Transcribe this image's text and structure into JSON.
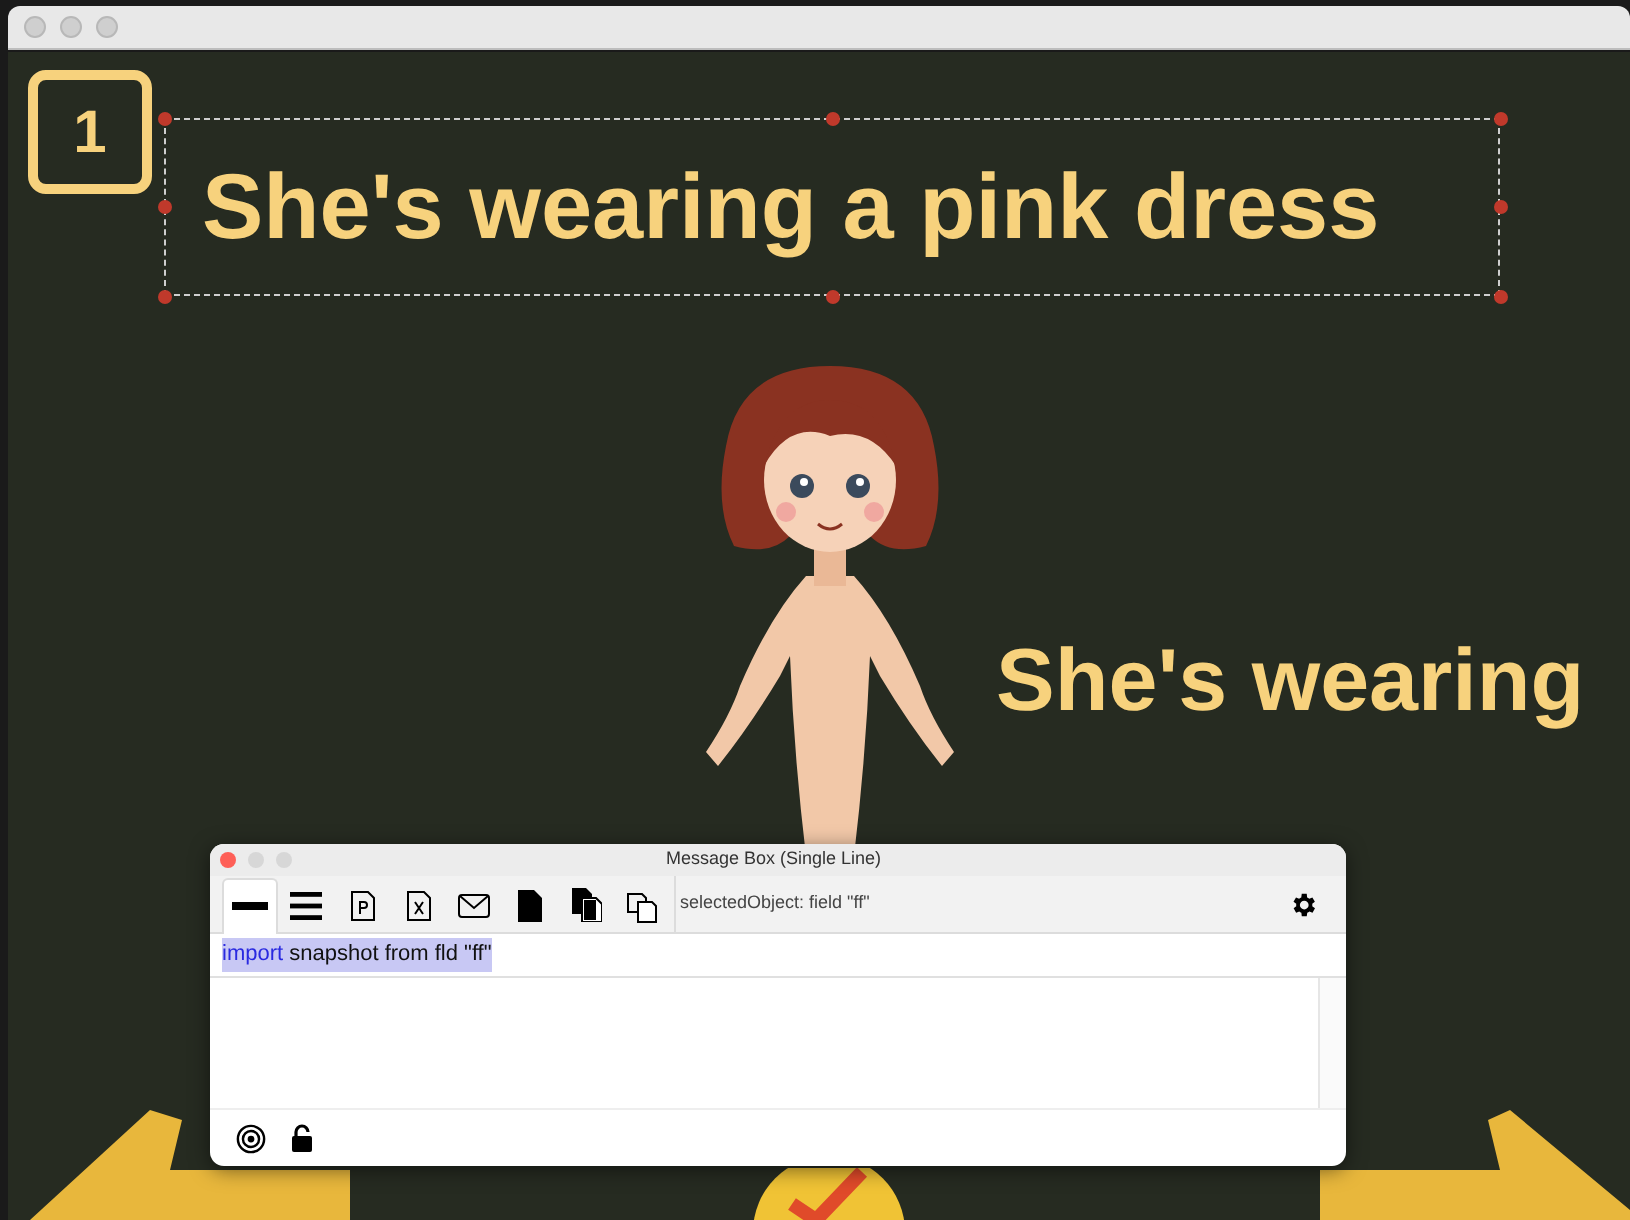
{
  "card": {
    "number": "1",
    "title": "She's wearing a pink dress",
    "title_selected": true,
    "caption": "She's wearing"
  },
  "message_box": {
    "title": "Message Box (Single Line)",
    "tools": [
      {
        "kind": "single-line",
        "selected": true
      },
      {
        "kind": "multi-line",
        "selected": false
      },
      {
        "kind": "page-doc",
        "selected": false
      },
      {
        "kind": "x-doc",
        "selected": false
      },
      {
        "kind": "mail",
        "selected": false
      },
      {
        "kind": "file",
        "selected": false
      },
      {
        "kind": "files",
        "selected": false
      },
      {
        "kind": "copies",
        "selected": false
      }
    ],
    "selected_object": "selectedObject: field \"ff\"",
    "command": {
      "keyword": "import",
      "rest": " snapshot from fld \"ff\"",
      "selected": true
    }
  }
}
